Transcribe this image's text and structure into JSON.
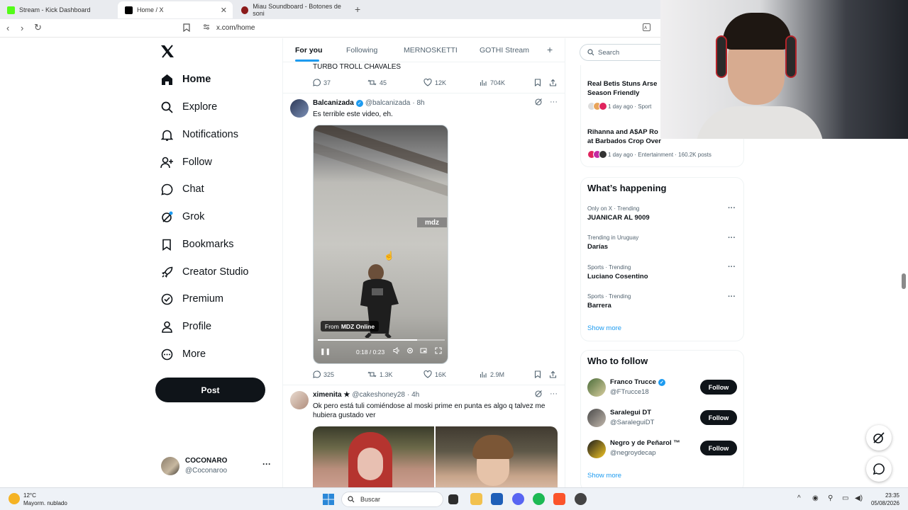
{
  "browser": {
    "tabs": [
      {
        "title": "Stream - Kick Dashboard",
        "favicon_color": "#53fc18"
      },
      {
        "title": "Home / X",
        "favicon_color": "#000000"
      },
      {
        "title": "Miau Soundboard - Botones de soni",
        "favicon_color": "#8b1a1a"
      }
    ],
    "url": "x.com/home"
  },
  "sidebar": {
    "items": [
      {
        "label": "Home",
        "icon": "home-icon"
      },
      {
        "label": "Explore",
        "icon": "search-icon"
      },
      {
        "label": "Notifications",
        "icon": "bell-icon"
      },
      {
        "label": "Follow",
        "icon": "person-add-icon"
      },
      {
        "label": "Chat",
        "icon": "chat-icon"
      },
      {
        "label": "Grok",
        "icon": "grok-icon"
      },
      {
        "label": "Bookmarks",
        "icon": "bookmark-icon"
      },
      {
        "label": "Creator Studio",
        "icon": "rocket-icon"
      },
      {
        "label": "Premium",
        "icon": "verified-icon"
      },
      {
        "label": "Profile",
        "icon": "profile-icon"
      },
      {
        "label": "More",
        "icon": "more-circle-icon"
      }
    ],
    "post_label": "Post",
    "account": {
      "name": "COCONARO",
      "handle": "@Coconaroo"
    }
  },
  "feed": {
    "tabs": [
      "For you",
      "Following",
      "MERNOSKETTI",
      "GOTHI Stream"
    ],
    "prev_text": "TURBO TROLL CHAVALES",
    "prev_stats": {
      "replies": "37",
      "reposts": "45",
      "likes": "12K",
      "views": "704K"
    },
    "tweet1": {
      "name": "Balcanizada",
      "handle": "@balcanizada",
      "time": "· 8h",
      "text": "Es terrible este video, eh.",
      "video": {
        "from_label": "From",
        "source": "MDZ Online",
        "logo": "mdz",
        "time": "0:18 / 0:23",
        "progress": 0.78
      },
      "stats": {
        "replies": "325",
        "reposts": "1.3K",
        "likes": "16K",
        "views": "2.9M"
      }
    },
    "tweet2": {
      "name": "ximenita ★",
      "handle": "@cakeshoney28",
      "time": "· 4h",
      "text": "Ok pero está tuli comiéndose al moski prime en punta es algo q talvez me hubiera gustado ver"
    }
  },
  "right": {
    "search_placeholder": "Search",
    "news": [
      {
        "title": "Real Betis Stuns Arse Season Friendly",
        "meta": "1 day ago · Sport"
      },
      {
        "title": "Rihanna and A$AP Ro at Barbados Crop Over",
        "meta": "1 day ago · Entertainment · 160.2K posts"
      }
    ],
    "happening_title": "What’s happening",
    "trends": [
      {
        "meta": "Only on X · Trending",
        "name": "JUANICAR AL 9009"
      },
      {
        "meta": "Trending in Uruguay",
        "name": "Darías"
      },
      {
        "meta": "Sports · Trending",
        "name": "Luciano Cosentino"
      },
      {
        "meta": "Sports · Trending",
        "name": "Barrera"
      }
    ],
    "show_more": "Show more",
    "who_title": "Who to follow",
    "who": [
      {
        "name": "Franco Trucce",
        "handle": "@FTrucce18",
        "verified": true
      },
      {
        "name": "Saralegui DT",
        "handle": "@SaraleguiDT",
        "verified": false
      },
      {
        "name": "Negro y de Peñarol ™",
        "handle": "@negroydecap",
        "verified": false
      }
    ],
    "follow_label": "Follow"
  },
  "taskbar": {
    "temp": "12°C",
    "weather": "Mayorm. nublado",
    "search_label": "Buscar",
    "time": "23:35",
    "date": "05/08/2026"
  }
}
